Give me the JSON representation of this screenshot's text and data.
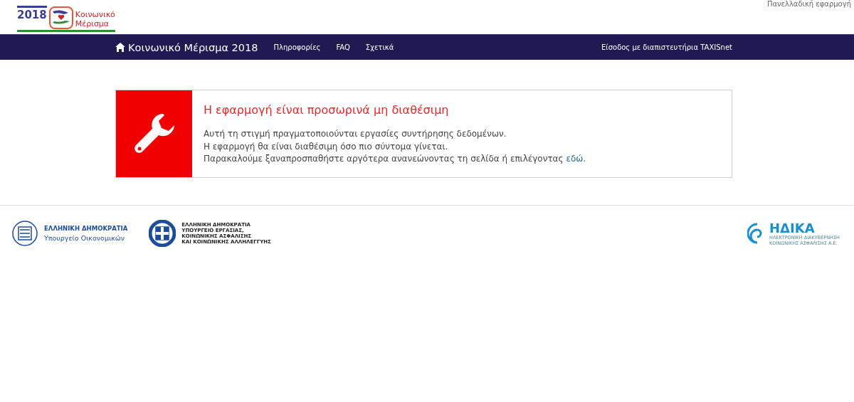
{
  "header": {
    "logo": {
      "year": "2018",
      "line1": "Κοινωνικό",
      "line2": "Μέρισμα"
    },
    "tagline": "Πανελλαδική εφαρμογή"
  },
  "navbar": {
    "brand": "Κοινωνικό Μέρισμα 2018",
    "links": [
      "Πληροφορίες",
      "FAQ",
      "Σχετικά"
    ],
    "login": "Είσοδος με διαπιστευτήρια TAXISnet"
  },
  "alert": {
    "title": "Η εφαρμογή είναι προσωρινά μη διαθέσιμη",
    "lines": [
      "Αυτή τη στιγμή πραγματοποιούνται εργασίες συντήρησης δεδομένων.",
      "Η εφαρμογή θα είναι διαθέσιμη όσο πιο σύντομα γίνεται.",
      "Παρακαλούμε ξαναπροσπαθήστε αργότερα ανανεώνοντας τη σελίδα ή επιλέγοντας"
    ],
    "link": "εδώ",
    "after_link": "."
  },
  "footer": {
    "ministry_finance": {
      "title": "ΕΛΛΗΝΙΚΗ ΔΗΜΟΚΡΑΤΙΑ",
      "subtitle": "Υπουργείο Οικονομικών"
    },
    "ministry_labour": [
      "ΕΛΛΗΝΙΚΗ ΔΗΜΟΚΡΑΤΙΑ",
      "ΥΠΟΥΡΓΕΙΟ ΕΡΓΑΣΙΑΣ,",
      "ΚΟΙΝΩΝΙΚΗΣ ΑΣΦΑΛΙΣΗΣ",
      "ΚΑΙ ΚΟΙΝΩΝΙΚΗΣ ΑΛΛΗΛΕΓΓΥΗΣ"
    ],
    "idika": {
      "name": "ΗΔΙΚΑ",
      "lines": [
        "ΗΛΕΚΤΡΟΝΙΚΗ ΔΙΑΚΥΒΕΡΝΗΣΗ",
        "ΚΟΙΝΩΝΙΚΗΣ ΑΣΦΑΛΙΣΗΣ Α.Ε."
      ]
    }
  }
}
